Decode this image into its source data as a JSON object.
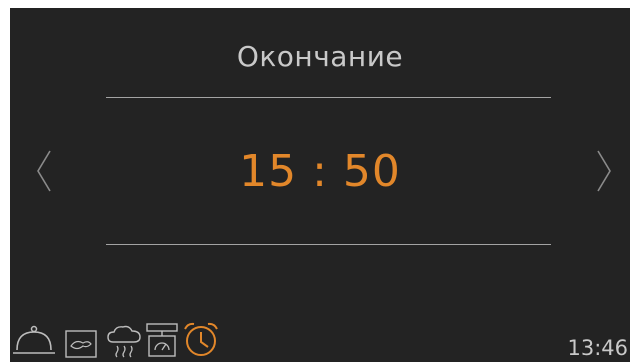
{
  "screen": {
    "title": "Окончание",
    "value": "15 : 50",
    "current_time": "13:46",
    "accent_color": "#e2872a",
    "text_color": "#c9c9c9",
    "background_color": "#232323"
  },
  "navigation": {
    "prev_icon": "chevron-left-icon",
    "next_icon": "chevron-right-icon"
  },
  "bottom_icons": [
    {
      "name": "cloche-icon",
      "active": false
    },
    {
      "name": "oven-icon",
      "active": false
    },
    {
      "name": "steam-cloud-icon",
      "active": false
    },
    {
      "name": "scale-icon",
      "active": false
    },
    {
      "name": "alarm-clock-icon",
      "active": true
    }
  ]
}
